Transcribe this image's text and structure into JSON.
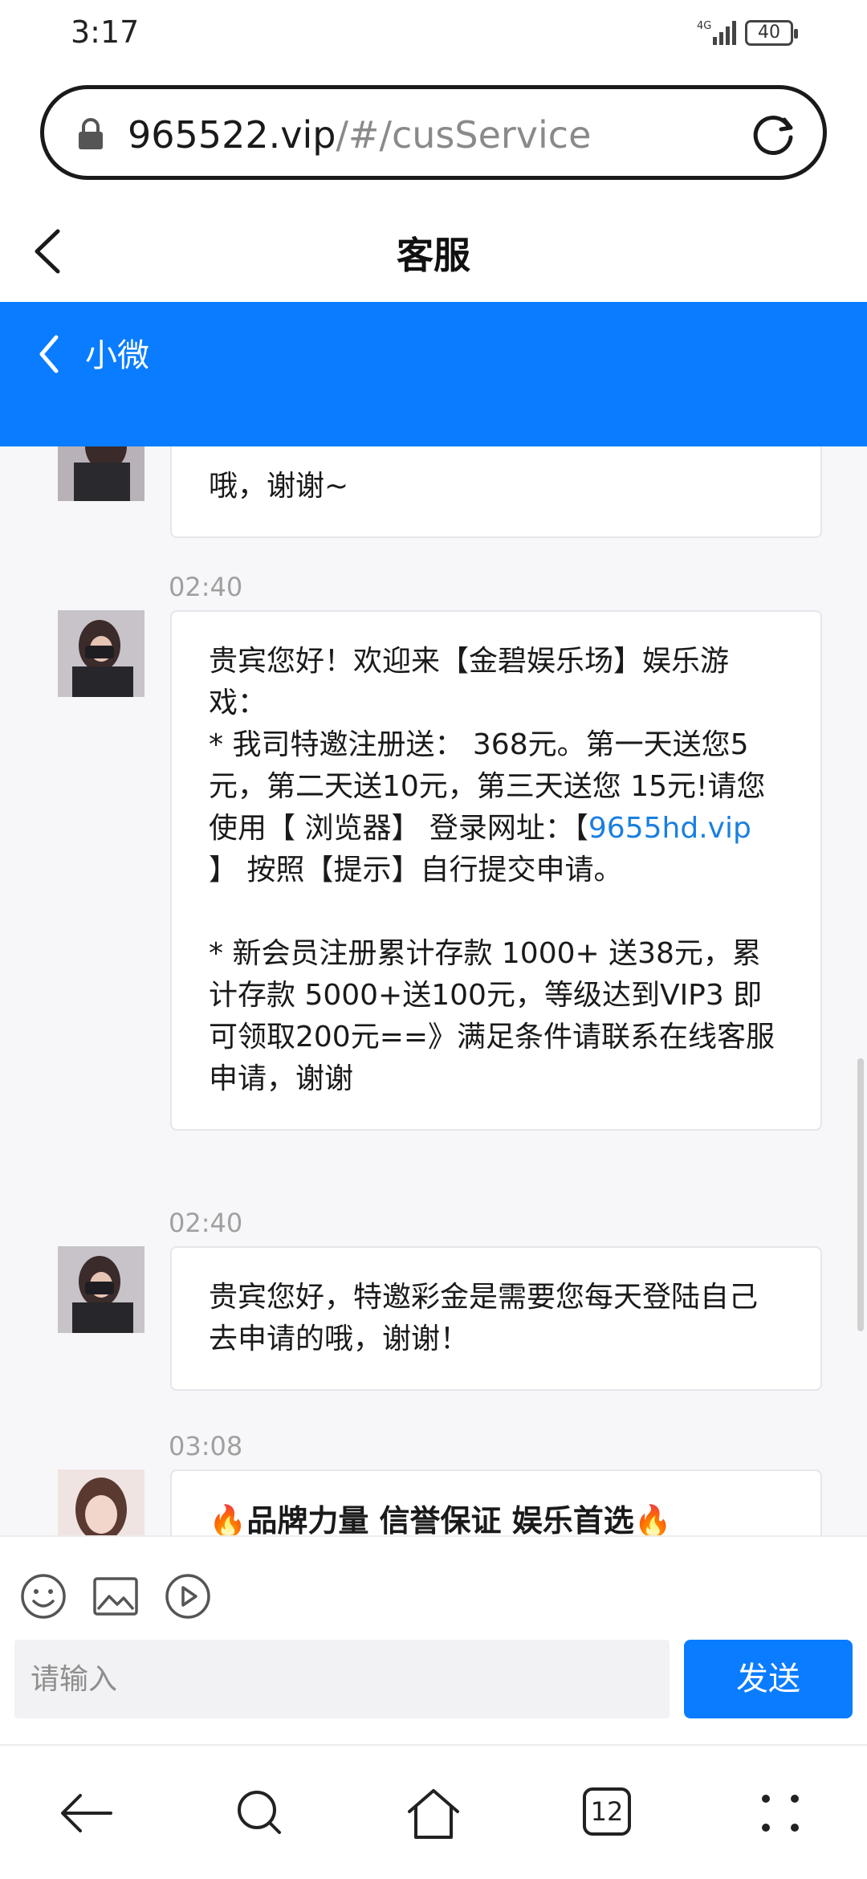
{
  "status_bar": {
    "time": "3:17",
    "network": "4G",
    "battery": "40"
  },
  "url_bar": {
    "host": "965522.vip",
    "path": "/#/cusService"
  },
  "header": {
    "title": "客服"
  },
  "chat_bar": {
    "name": "小微"
  },
  "messages": [
    {
      "time": "",
      "text": "哦，谢谢~"
    },
    {
      "time": "02:40",
      "paragraphs": [
        "贵宾您好！欢迎来【金碧娱乐场】娱乐游戏：",
        "* 我司特邀注册送： 368元。第一天送您5元，第二天送10元，第三天送您 15元!请您使用【 浏览器】 登录网址：",
        "【",
        "9655hd.vip",
        " 】 按照【提示】自行提交申请。",
        "* 新会员注册累计存款 1000+ 送38元，累计存款 5000+送100元，等级达到VIP3 即可领取200元==》满足条件请联系在线客服申请，谢谢"
      ]
    },
    {
      "time": "02:40",
      "text": "贵宾您好，特邀彩金是需要您每天登陆自己去申请的哦，谢谢！"
    },
    {
      "time": "03:08",
      "text": "品牌力量 信誉保证 娱乐首选"
    }
  ],
  "input": {
    "placeholder": "请输入",
    "value": "",
    "send_label": "发送"
  },
  "nav": {
    "tabs_count": "12"
  },
  "colors": {
    "accent": "#0a7cff",
    "link": "#1a7fe0"
  }
}
